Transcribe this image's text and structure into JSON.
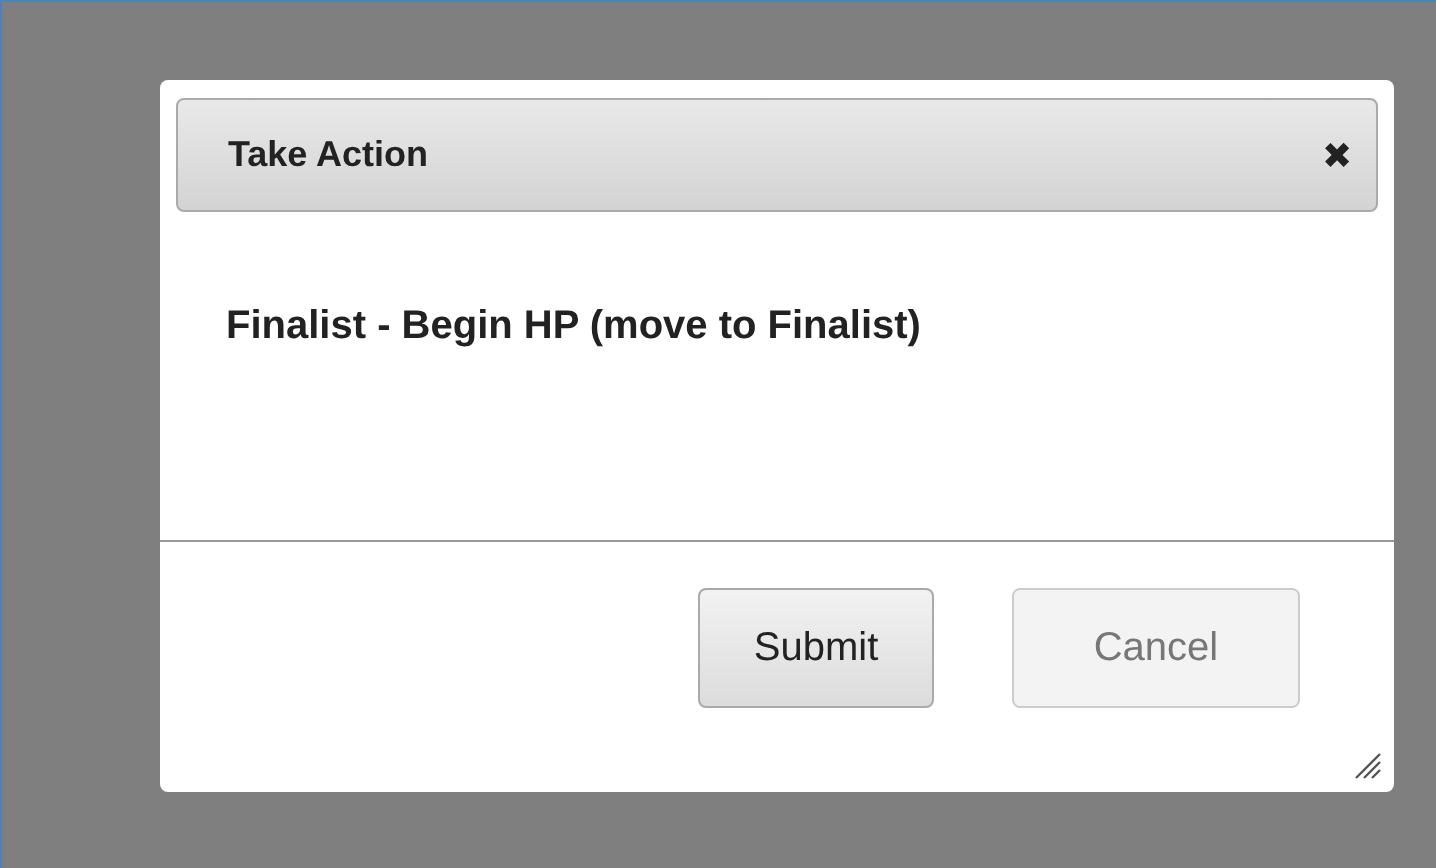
{
  "dialog": {
    "title": "Take Action",
    "close": "✖",
    "message": "Finalist - Begin HP (move to Finalist)",
    "buttons": [
      {
        "label": "Submit",
        "disabled": false
      },
      {
        "label": "Cancel",
        "disabled": true
      }
    ]
  }
}
